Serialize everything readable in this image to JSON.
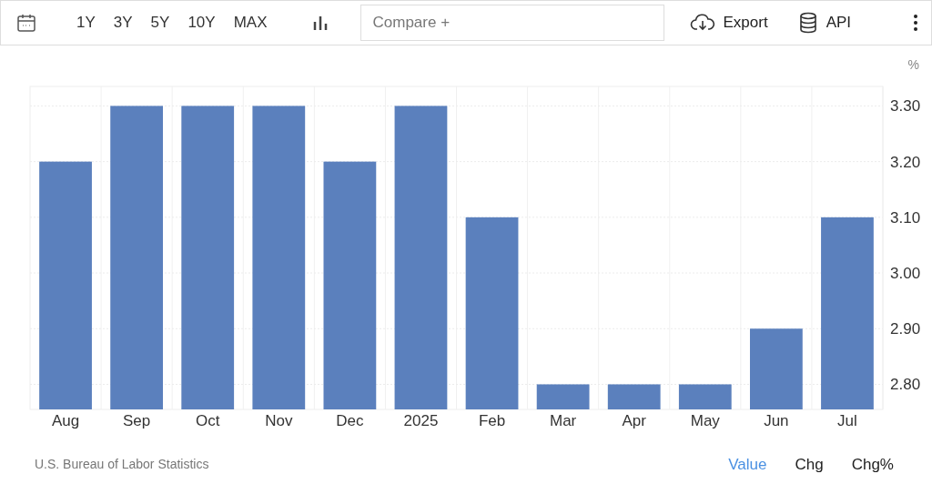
{
  "toolbar": {
    "ranges": [
      {
        "label": "1Y",
        "selected": false
      },
      {
        "label": "3Y",
        "selected": false
      },
      {
        "label": "5Y",
        "selected": false
      },
      {
        "label": "10Y",
        "selected": false
      },
      {
        "label": "MAX",
        "selected": false
      }
    ],
    "compare": {
      "placeholder": "Compare +"
    },
    "export": "Export",
    "api": "API"
  },
  "chart": {
    "unit": "%",
    "chart_data": {
      "type": "bar",
      "categories": [
        "Aug",
        "Sep",
        "Oct",
        "Nov",
        "Dec",
        "2025",
        "Feb",
        "Mar",
        "Apr",
        "May",
        "Jun",
        "Jul"
      ],
      "grid": true,
      "series": [
        {
          "color": "#5b80bd",
          "values": [
            3.2,
            3.3,
            3.3,
            3.3,
            3.2,
            3.3,
            3.1,
            2.8,
            2.8,
            2.8,
            2.9,
            3.1
          ]
        }
      ],
      "ylim": [
        2.755,
        3.335
      ],
      "yticks": [
        {
          "value": 2.8,
          "label": "2.80"
        },
        {
          "value": 2.9,
          "label": "2.90"
        },
        {
          "value": 3.0,
          "label": "3.00"
        },
        {
          "value": 3.1,
          "label": "3.10"
        },
        {
          "value": 3.2,
          "label": "3.20"
        },
        {
          "value": 3.3,
          "label": "3.30"
        }
      ]
    }
  },
  "footer": {
    "source": "U.S. Bureau of Labor Statistics",
    "views": [
      {
        "label": "Value",
        "selected": true
      },
      {
        "label": "Chg",
        "selected": false
      },
      {
        "label": "Chg%",
        "selected": false
      }
    ]
  }
}
